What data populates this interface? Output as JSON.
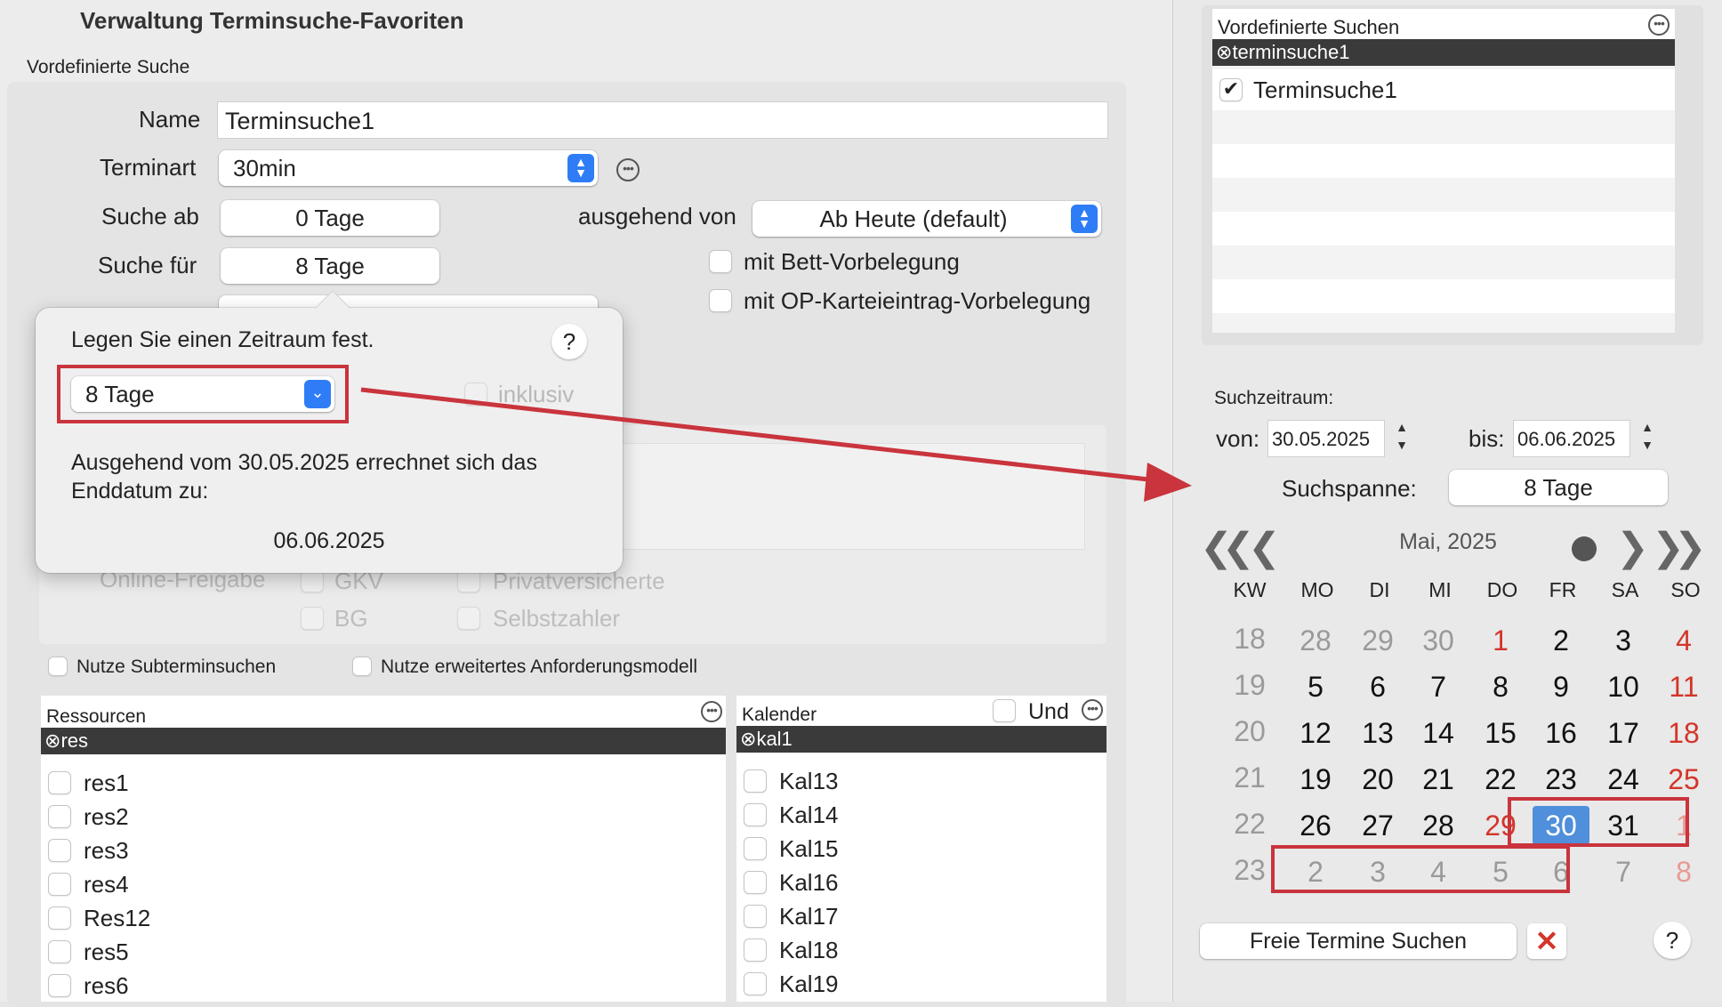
{
  "window_title": "Verwaltung Terminsuche-Favoriten",
  "section_label": "Vordefinierte Suche",
  "form": {
    "name_label": "Name",
    "name_value": "Terminsuche1",
    "terminart_label": "Terminart",
    "terminart_value": "30min",
    "suche_ab_label": "Suche ab",
    "suche_ab_value": "0 Tage",
    "ausgehend_label": "ausgehend von",
    "ausgehend_value": "Ab Heute (default)",
    "suche_fuer_label": "Suche für",
    "suche_fuer_value": "8 Tage",
    "bett_label": "mit Bett-Vorbelegung",
    "op_label": "mit OP-Karteieintrag-Vorbelegung",
    "online_label": "Online-Freigabe",
    "gkv_label": "GKV",
    "privat_label": "Privatversicherte",
    "bg_label": "BG",
    "selbst_label": "Selbstzahler",
    "subtermin_label": "Nutze Subterminsuchen",
    "anforderung_label": "Nutze erweitertes Anforderungsmodell"
  },
  "popover": {
    "title": "Legen Sie einen Zeitraum fest.",
    "help": "?",
    "period_value": "8 Tage",
    "inklusiv_label": "inklusiv",
    "desc": "Ausgehend vom 30.05.2025 errechnet sich das Enddatum zu:",
    "result": "06.06.2025"
  },
  "ressourcen": {
    "header": "Ressourcen",
    "filter": "res",
    "items": [
      "res1",
      "res2",
      "res3",
      "res4",
      "Res12",
      "res5",
      "res6"
    ]
  },
  "kalender": {
    "header": "Kalender",
    "und_label": "Und",
    "filter": "kal1",
    "items": [
      "Kal13",
      "Kal14",
      "Kal15",
      "Kal16",
      "Kal17",
      "Kal18",
      "Kal19"
    ]
  },
  "right": {
    "header": "Vordefinierte Suchen",
    "filter": "terminsuche1",
    "item": "Terminsuche1",
    "suchzeitraum_label": "Suchzeitraum:",
    "von_label": "von:",
    "von_value": "30.05.2025",
    "bis_label": "bis:",
    "bis_value": "06.06.2025",
    "suchspanne_label": "Suchspanne:",
    "suchspanne_value": "8 Tage",
    "month": "Mai, 2025",
    "dow": [
      "KW",
      "MO",
      "DI",
      "MI",
      "DO",
      "FR",
      "SA",
      "SO"
    ],
    "weeks": [
      {
        "kw": "18",
        "days": [
          "28",
          "29",
          "30",
          "1",
          "2",
          "3",
          "4"
        ]
      },
      {
        "kw": "19",
        "days": [
          "5",
          "6",
          "7",
          "8",
          "9",
          "10",
          "11"
        ]
      },
      {
        "kw": "20",
        "days": [
          "12",
          "13",
          "14",
          "15",
          "16",
          "17",
          "18"
        ]
      },
      {
        "kw": "21",
        "days": [
          "19",
          "20",
          "21",
          "22",
          "23",
          "24",
          "25"
        ]
      },
      {
        "kw": "22",
        "days": [
          "26",
          "27",
          "28",
          "29",
          "30",
          "31",
          "1"
        ]
      },
      {
        "kw": "23",
        "days": [
          "2",
          "3",
          "4",
          "5",
          "6",
          "7",
          "8"
        ]
      }
    ],
    "search_button": "Freie Termine Suchen",
    "help": "?"
  },
  "colors": {
    "accent": "#2f7df6",
    "selected_day": "#4f8fdb",
    "holiday_red": "#d2352a",
    "annotation_red": "#c9343d"
  }
}
